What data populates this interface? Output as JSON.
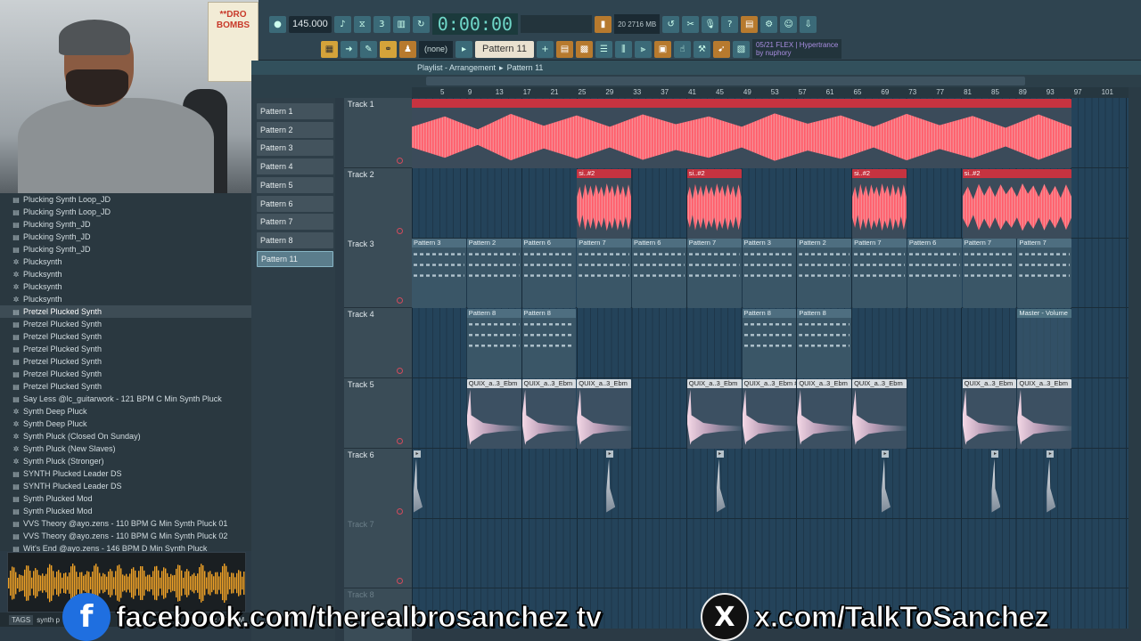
{
  "toolbar": {
    "tempo": "145.000",
    "time": "0:00:00",
    "memory_label": "2716 MB",
    "memory_sub": "0",
    "cpu": "20",
    "pattern_selector": "Pattern 11",
    "none_selector": "(none)",
    "hint_line1": "05/21 FLEX | Hypertrance",
    "hint_line2": "by nuphory"
  },
  "webcam": {
    "poster_text": "**DRO BOMBS"
  },
  "browser": {
    "items": [
      {
        "icon": "folder-icon",
        "label": "Plucking Synth Loop_JD"
      },
      {
        "icon": "folder-icon",
        "label": "Plucking Synth Loop_JD"
      },
      {
        "icon": "folder-icon",
        "label": "Plucking Synth_JD"
      },
      {
        "icon": "folder-icon",
        "label": "Plucking Synth_JD"
      },
      {
        "icon": "folder-icon",
        "label": "Plucking Synth_JD"
      },
      {
        "icon": "preset-icon",
        "label": "Plucksynth"
      },
      {
        "icon": "preset-icon",
        "label": "Plucksynth"
      },
      {
        "icon": "preset-icon",
        "label": "Plucksynth"
      },
      {
        "icon": "preset-icon",
        "label": "Plucksynth"
      },
      {
        "icon": "folder-icon",
        "label": "Pretzel Plucked Synth",
        "selected": true
      },
      {
        "icon": "folder-icon",
        "label": "Pretzel Plucked Synth"
      },
      {
        "icon": "folder-icon",
        "label": "Pretzel Plucked Synth"
      },
      {
        "icon": "folder-icon",
        "label": "Pretzel Plucked Synth"
      },
      {
        "icon": "folder-icon",
        "label": "Pretzel Plucked Synth"
      },
      {
        "icon": "folder-icon",
        "label": "Pretzel Plucked Synth"
      },
      {
        "icon": "folder-icon",
        "label": "Pretzel Plucked Synth"
      },
      {
        "icon": "folder-icon",
        "label": "Say Less @lc_guitarwork - 121 BPM C Min Synth Pluck"
      },
      {
        "icon": "preset-icon",
        "label": "Synth Deep Pluck"
      },
      {
        "icon": "preset-icon",
        "label": "Synth Deep Pluck"
      },
      {
        "icon": "preset-icon",
        "label": "Synth Pluck (Closed On Sunday)"
      },
      {
        "icon": "preset-icon",
        "label": "Synth Pluck (New Slaves)"
      },
      {
        "icon": "preset-icon",
        "label": "Synth Pluck (Stronger)"
      },
      {
        "icon": "folder-icon",
        "label": "SYNTH Plucked Leader DS"
      },
      {
        "icon": "folder-icon",
        "label": "SYNTH Plucked Leader DS"
      },
      {
        "icon": "folder-icon",
        "label": "Synth Plucked Mod"
      },
      {
        "icon": "folder-icon",
        "label": "Synth Plucked Mod"
      },
      {
        "icon": "folder-icon",
        "label": "VVS Theory @ayo.zens - 110 BPM G Min Synth Pluck 01"
      },
      {
        "icon": "folder-icon",
        "label": "VVS Theory @ayo.zens - 110 BPM G Min Synth Pluck 02"
      },
      {
        "icon": "folder-icon",
        "label": "Wit's End @ayo.zens - 146 BPM D Min Synth Pluck"
      }
    ],
    "tags_label": "TAGS",
    "search_text": "synth p",
    "sample_info": "kHz 67 BPM"
  },
  "picker": {
    "items": [
      "Pattern 1",
      "Pattern 2",
      "Pattern 3",
      "Pattern 4",
      "Pattern 5",
      "Pattern 6",
      "Pattern 7",
      "Pattern 8",
      "Pattern 11"
    ],
    "selected": "Pattern 11"
  },
  "playlist": {
    "title": "Playlist - Arrangement",
    "current_pattern": "Pattern 11",
    "ruler": [
      "5",
      "9",
      "13",
      "17",
      "21",
      "25",
      "29",
      "33",
      "37",
      "41",
      "45",
      "49",
      "53",
      "57",
      "61",
      "65",
      "69",
      "73",
      "77",
      "81",
      "85",
      "89",
      "93",
      "97",
      "101"
    ],
    "tracks": [
      "Track 1",
      "Track 2",
      "Track 3",
      "Track 4",
      "Track 5",
      "Track 6",
      "Track 7",
      "Track 8"
    ],
    "clips": {
      "audio_short": "si..#2",
      "pattern_3": "Pattern 3",
      "pattern_2": "Pattern 2",
      "pattern_6": "Pattern 6",
      "pattern_7": "Pattern 7",
      "pattern_8": "Pattern 8",
      "automation": "Master - Volume",
      "pluck": "QUIX_a..3_Ebm",
      "pluck_alt": "QUIX_a..3_Ebm #2"
    }
  },
  "social": {
    "facebook_url": "facebook.com/therealbrosanchez tv",
    "x_url": "x.com/TalkToSanchez"
  }
}
